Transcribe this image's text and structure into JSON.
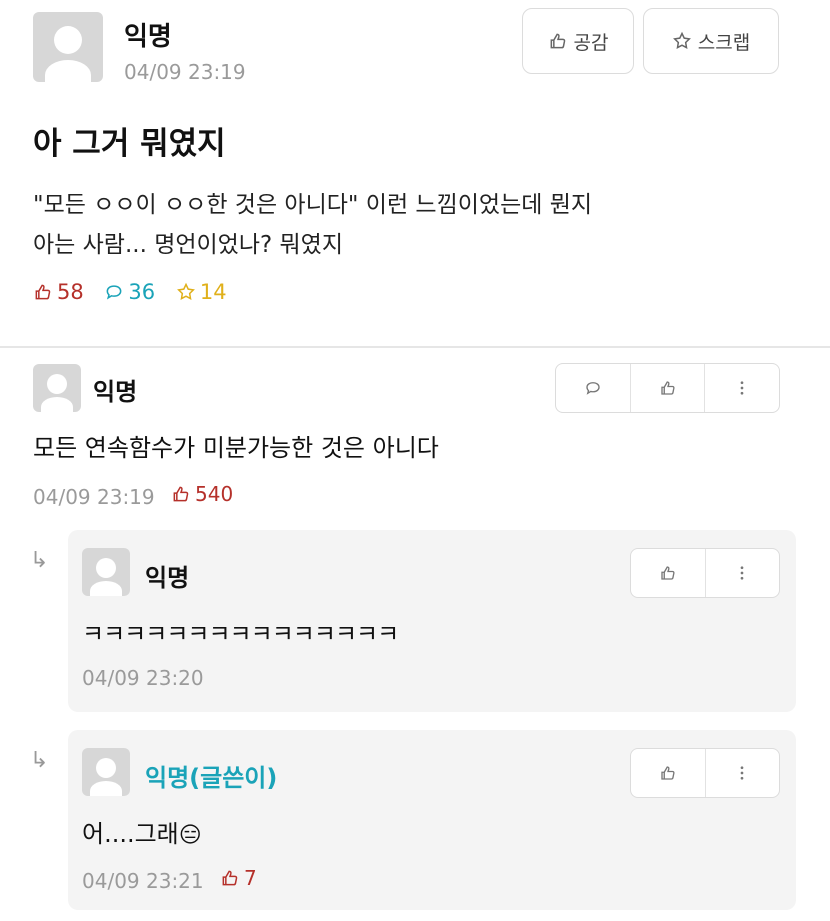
{
  "post": {
    "author": "익명",
    "timestamp": "04/09 23:19",
    "like_label": "공감",
    "scrap_label": "스크랩",
    "title": "아 그거 뭐였지",
    "body_line1": "\"모든 ㅇㅇ이 ㅇㅇ한 것은 아니다\" 이런 느낌이었는데 뭔지",
    "body_line2": "아는 사람... 명언이었나? 뭐였지",
    "likes": "58",
    "comments": "36",
    "scraps": "14",
    "colors": {
      "likes": "#b5302a",
      "comments": "#1aa3b8",
      "scraps": "#e0b01a"
    }
  },
  "comments": [
    {
      "author": "익명",
      "text": "모든 연속함수가 미분가능한 것은 아니다",
      "timestamp": "04/09 23:19",
      "likes": "540",
      "replies": [
        {
          "author": "익명",
          "text": "ㅋㅋㅋㅋㅋㅋㅋㅋㅋㅋㅋㅋㅋㅋㅋ",
          "timestamp": "04/09 23:20"
        },
        {
          "author": "익명(글쓴이)",
          "text": "어....그래",
          "emoji": "😑",
          "timestamp": "04/09 23:21",
          "likes": "7"
        }
      ]
    }
  ],
  "icons": [
    "thumbs-up-icon",
    "star-icon",
    "comment-icon",
    "more-icon",
    "reply-arrow-icon"
  ]
}
